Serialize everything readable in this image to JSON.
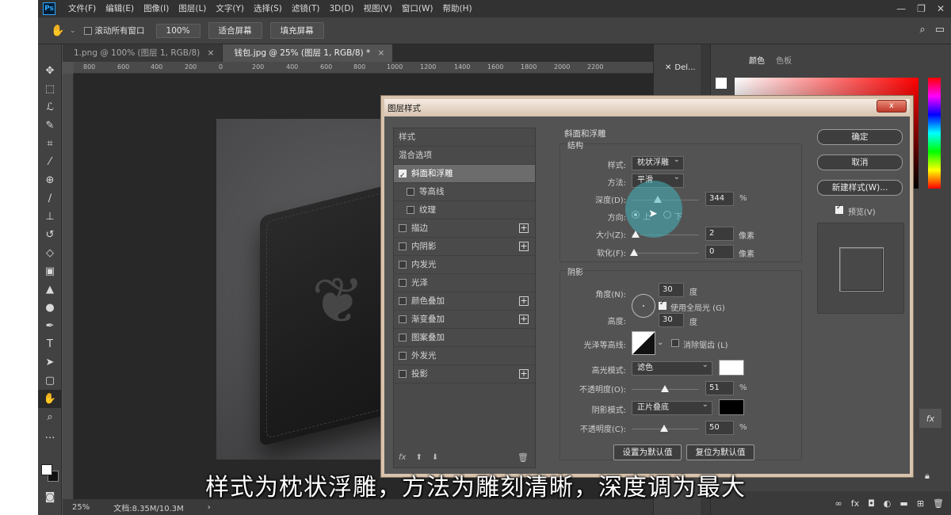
{
  "menu": {
    "app_icon": "Ps",
    "items": [
      "文件(F)",
      "编辑(E)",
      "图像(I)",
      "图层(L)",
      "文字(Y)",
      "选择(S)",
      "滤镜(T)",
      "3D(D)",
      "视图(V)",
      "窗口(W)",
      "帮助(H)"
    ]
  },
  "options": {
    "scroll_all": "滚动所有窗口",
    "zoom": "100%",
    "fit_screen": "适合屏幕",
    "fill_screen": "填充屏幕"
  },
  "tabs": [
    {
      "label": "1.png @ 100% (图层 1, RGB/8)"
    },
    {
      "label": "钱包.jpg @ 25% (图层 1, RGB/8) *"
    }
  ],
  "ruler": [
    "800",
    "600",
    "400",
    "200",
    "0",
    "200",
    "400",
    "600",
    "800",
    "1000",
    "1200",
    "1400",
    "1600",
    "1800",
    "2000",
    "2200"
  ],
  "status": {
    "zoom": "25%",
    "doc": "文档:8.35M/10.3M"
  },
  "mini_panel": {
    "label": "Del..."
  },
  "right_panel": {
    "tab_color": "颜色",
    "tab_swatches": "色板"
  },
  "dialog": {
    "title": "图层样式",
    "close": "x",
    "styles_header": "样式",
    "blending": "混合选项",
    "items": [
      {
        "label": "斜面和浮雕",
        "checked": true,
        "selected": true
      },
      {
        "label": "等高线",
        "sub": true
      },
      {
        "label": "纹理",
        "sub": true
      },
      {
        "label": "描边",
        "plus": true
      },
      {
        "label": "内阴影",
        "plus": true
      },
      {
        "label": "内发光"
      },
      {
        "label": "光泽"
      },
      {
        "label": "颜色叠加",
        "plus": true
      },
      {
        "label": "渐变叠加",
        "plus": true
      },
      {
        "label": "图案叠加"
      },
      {
        "label": "外发光"
      },
      {
        "label": "投影",
        "plus": true
      }
    ],
    "fx": "fx",
    "bevel": {
      "title": "斜面和浮雕",
      "structure": "结构",
      "style_label": "样式:",
      "style_value": "枕状浮雕",
      "technique_label": "方法:",
      "technique_value": "平滑",
      "depth_label": "深度(D):",
      "depth_value": "344",
      "depth_unit": "%",
      "direction_label": "方向:",
      "dir_up": "上",
      "dir_down": "下",
      "size_label": "大小(Z):",
      "size_value": "2",
      "size_unit": "像素",
      "soften_label": "软化(F):",
      "soften_value": "0",
      "soften_unit": "像素"
    },
    "shading": {
      "title": "阴影",
      "angle_label": "角度(N):",
      "angle_value": "30",
      "angle_unit": "度",
      "global_light": "使用全局光 (G)",
      "altitude_label": "高度:",
      "altitude_value": "30",
      "altitude_unit": "度",
      "gloss_label": "光泽等高线:",
      "anti_alias": "消除锯齿 (L)",
      "highlight_label": "高光模式:",
      "highlight_mode": "滤色",
      "highlight_color": "#ffffff",
      "hl_opacity_label": "不透明度(O):",
      "hl_opacity_value": "51",
      "hl_opacity_unit": "%",
      "shadow_label": "阴影模式:",
      "shadow_mode": "正片叠底",
      "shadow_color": "#000000",
      "sh_opacity_label": "不透明度(C):",
      "sh_opacity_value": "50",
      "sh_opacity_unit": "%"
    },
    "set_default": "设置为默认值",
    "reset_default": "复位为默认值",
    "ok": "确定",
    "cancel": "取消",
    "new_style": "新建样式(W)...",
    "preview": "预览(V)"
  },
  "subtitle": "样式为枕状浮雕，方法为雕刻清晰，深度调为最大"
}
